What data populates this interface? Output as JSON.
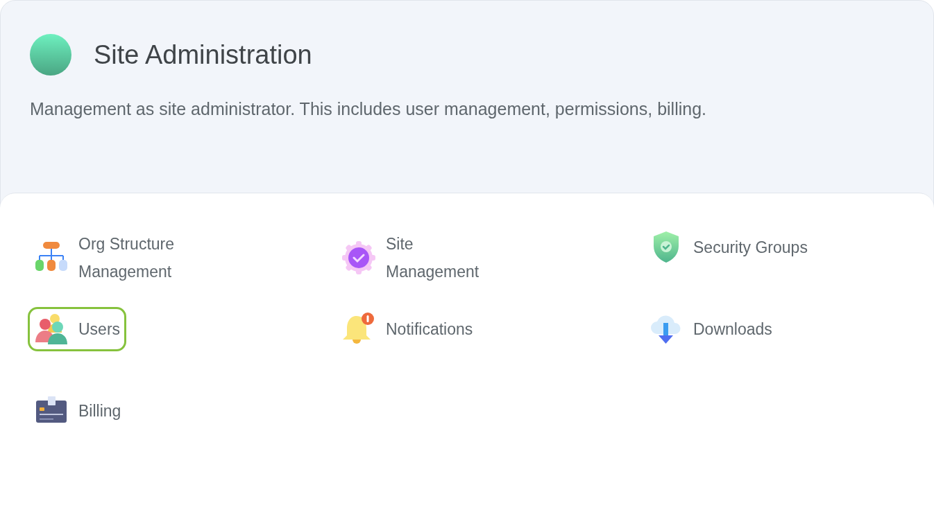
{
  "header": {
    "title": "Site Administration",
    "description": "Management as site administrator. This includes user management, permissions, billing."
  },
  "items": [
    {
      "label": "Org Structure Management",
      "kind": "org",
      "selected": false
    },
    {
      "label": "Site Management",
      "kind": "site",
      "selected": false
    },
    {
      "label": "Security Groups",
      "kind": "security",
      "selected": false
    },
    {
      "label": "Users",
      "kind": "users",
      "selected": true
    },
    {
      "label": "Notifications",
      "kind": "notifications",
      "selected": false
    },
    {
      "label": "Downloads",
      "kind": "downloads",
      "selected": false
    },
    {
      "label": "Billing",
      "kind": "billing",
      "selected": false
    }
  ]
}
